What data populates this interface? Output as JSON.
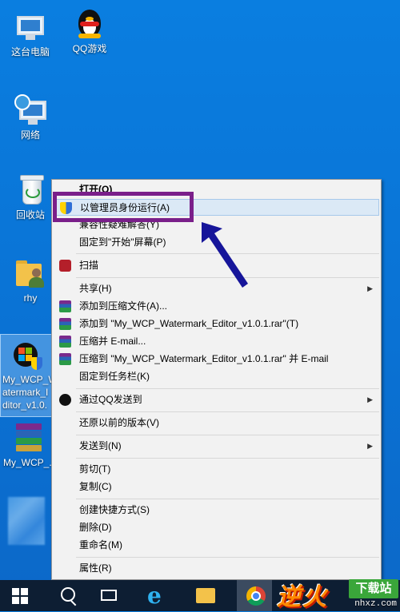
{
  "desktop": {
    "icons": [
      {
        "label": "这台电脑"
      },
      {
        "label": "QQ游戏"
      },
      {
        "label": "网络"
      },
      {
        "label": "回收站"
      },
      {
        "label": "rhy"
      },
      {
        "label_lines": [
          "My_WCP_W",
          "atermark_I",
          "ditor_v1.0."
        ]
      },
      {
        "label": "My_WCP_..."
      }
    ]
  },
  "context_menu": {
    "items": [
      {
        "label": "打开(O)"
      },
      {
        "label": "以管理员身份运行(A)"
      },
      {
        "label": "兼容性疑难解答(Y)"
      },
      {
        "label": "固定到\"开始\"屏幕(P)"
      },
      {
        "label": "扫描"
      },
      {
        "label": "共享(H)"
      },
      {
        "label": "添加到压缩文件(A)..."
      },
      {
        "label": "添加到 \"My_WCP_Watermark_Editor_v1.0.1.rar\"(T)"
      },
      {
        "label": "压缩并 E-mail..."
      },
      {
        "label": "压缩到 \"My_WCP_Watermark_Editor_v1.0.1.rar\" 并 E-mail"
      },
      {
        "label": "固定到任务栏(K)"
      },
      {
        "label": "通过QQ发送到"
      },
      {
        "label": "还原以前的版本(V)"
      },
      {
        "label": "发送到(N)"
      },
      {
        "label": "剪切(T)"
      },
      {
        "label": "复制(C)"
      },
      {
        "label": "创建快捷方式(S)"
      },
      {
        "label": "删除(D)"
      },
      {
        "label": "重命名(M)"
      },
      {
        "label": "属性(R)"
      }
    ],
    "highlighted_index": 1,
    "submenu_arrow": "▶"
  },
  "annotation": {
    "color": "#7a1f8a",
    "arrow_color": "#16159a"
  },
  "taskbar": {
    "buttons": [
      "start-icon",
      "search-icon",
      "task-view-icon",
      "internet-explorer-icon",
      "file-explorer-icon",
      "chrome-icon"
    ],
    "ie_glyph": "e"
  },
  "watermark": {
    "brand": "逆火",
    "box": "下载站",
    "url": "nhxz.com"
  }
}
